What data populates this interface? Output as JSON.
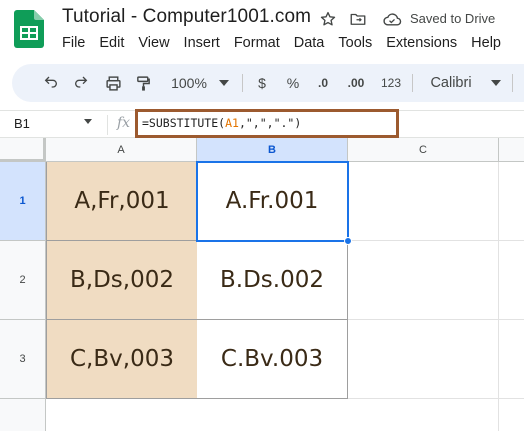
{
  "app": {
    "doc_title": "Tutorial - Computer1001.com",
    "saved_status": "Saved to Drive",
    "icons": [
      "sheets-logo-icon",
      "star-icon",
      "move-to-folder-icon",
      "cloud-saved-icon"
    ]
  },
  "menu": {
    "items": [
      "File",
      "Edit",
      "View",
      "Insert",
      "Format",
      "Data",
      "Tools",
      "Extensions",
      "Help"
    ]
  },
  "toolbar": {
    "zoom": "100%",
    "currency": "$",
    "percent": "%",
    "decrease_decimal": ".0",
    "increase_decimal": ".00",
    "number_format": "123",
    "font": "Calibri"
  },
  "formula_bar": {
    "cell_ref": "B1",
    "fx": "fx",
    "formula_prefix": "=SUBSTITUTE(",
    "formula_ref": "A1",
    "formula_suffix": ",\",\",\".\")"
  },
  "grid": {
    "columns": [
      "A",
      "B",
      "C"
    ],
    "rows": [
      "1",
      "2",
      "3"
    ],
    "cells": [
      [
        "A,Fr,001",
        "A.Fr.001",
        ""
      ],
      [
        "B,Ds,002",
        "B.Ds.002",
        ""
      ],
      [
        "C,Bv,003",
        "C.Bv.003",
        ""
      ]
    ],
    "selected_cell": "B1",
    "colors": {
      "column_a_fill": "#f0dcc2",
      "selection": "#1a73e8",
      "formula_highlight_border": "#9c5a2f",
      "formula_ref_color": "#e37400"
    }
  }
}
